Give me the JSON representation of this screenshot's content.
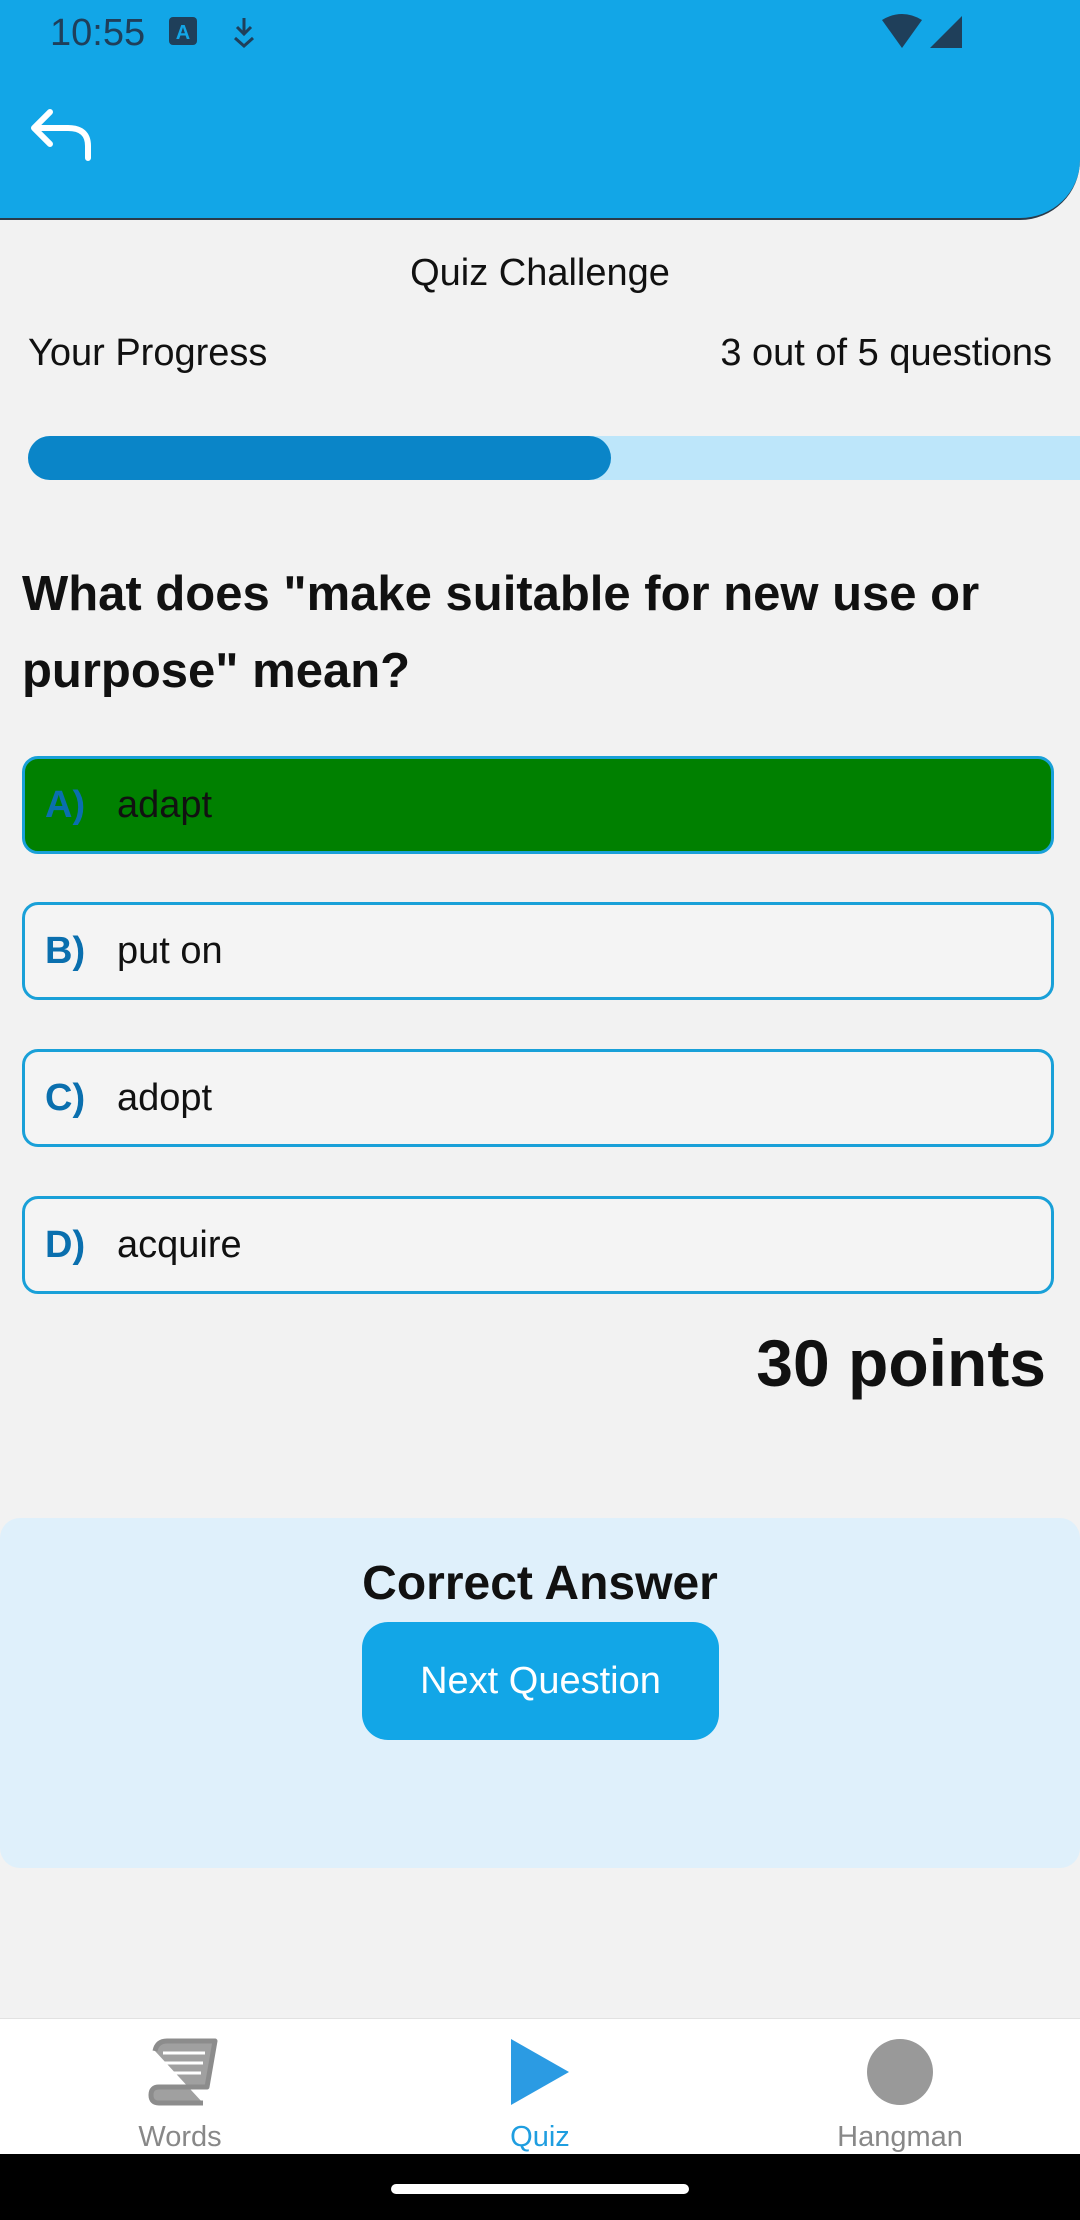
{
  "status_bar": {
    "time": "10:55",
    "icons": [
      "app-a-icon",
      "download-icon",
      "wifi-icon",
      "signal-icon"
    ]
  },
  "header": {
    "back_icon": "back-arrow-icon",
    "color": "#12a6e7"
  },
  "quiz": {
    "title": "Quiz Challenge"
  },
  "progress": {
    "label": "Your Progress",
    "count_text": "3 out of 5 questions",
    "fraction": 0.6
  },
  "question": {
    "text": "What does \"make suitable for new use or purpose\" mean?"
  },
  "options": [
    {
      "letter": "A)",
      "text": "adapt",
      "state": "correct"
    },
    {
      "letter": "B)",
      "text": "put on",
      "state": "default"
    },
    {
      "letter": "C)",
      "text": "adopt",
      "state": "default"
    },
    {
      "letter": "D)",
      "text": "acquire",
      "state": "default"
    }
  ],
  "score": {
    "text": "30 points"
  },
  "result": {
    "title": "Correct Answer",
    "next_button": "Next Question"
  },
  "bottom_nav": {
    "items": [
      {
        "label": "Words",
        "icon": "book-icon",
        "active": false
      },
      {
        "label": "Quiz",
        "icon": "play-icon",
        "active": true
      },
      {
        "label": "Hangman",
        "icon": "circle-icon",
        "active": false
      }
    ]
  },
  "colors": {
    "accent": "#12a6e7",
    "correct": "#008000",
    "progress_fill": "#0a85c8",
    "progress_track": "#bde6fa",
    "active_nav": "#1f9ee0"
  }
}
